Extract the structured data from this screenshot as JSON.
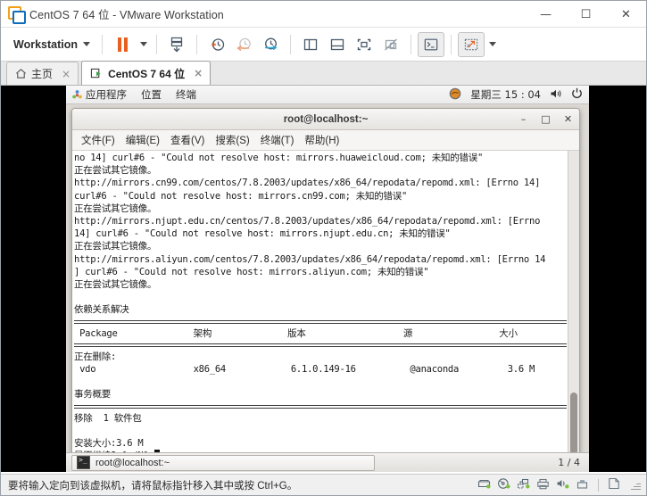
{
  "window": {
    "title": "CentOS 7 64 位 - VMware Workstation",
    "logo_icon": "vmware-logo-icon",
    "minimize_label": "—",
    "maximize_label": "☐",
    "close_label": "✕"
  },
  "toolbar": {
    "workstation_menu": "Workstation",
    "buttons": [
      {
        "name": "pause-vm-button",
        "icon": "pause-icon"
      },
      {
        "name": "pause-dropdown-button",
        "icon": "chevron-down-icon"
      },
      {
        "name": "snapshot-button",
        "icon": "snapshot-icon"
      },
      {
        "name": "take-snapshot-button",
        "icon": "clock-plus-icon"
      },
      {
        "name": "revert-snapshot-button",
        "icon": "clock-back-icon"
      },
      {
        "name": "snapshot-manager-button",
        "icon": "clock-wrench-icon"
      },
      {
        "name": "show-sidebar-button",
        "icon": "sidebar-panel-icon"
      },
      {
        "name": "show-thumbnail-bar-button",
        "icon": "bottom-panel-icon"
      },
      {
        "name": "full-screen-button",
        "icon": "fullscreen-icon"
      },
      {
        "name": "unity-mode-button",
        "icon": "unity-off-icon"
      },
      {
        "name": "console-view-button",
        "icon": "terminal-prompt-icon"
      },
      {
        "name": "stretch-guest-button",
        "icon": "stretch-icon"
      },
      {
        "name": "stretch-dropdown-button",
        "icon": "chevron-down-icon"
      }
    ]
  },
  "tabs": [
    {
      "name": "tab-home",
      "label": "主页",
      "icon": "home-icon",
      "close_label": "×",
      "active": false
    },
    {
      "name": "tab-centos",
      "label": "CentOS 7 64 位",
      "icon": "vm-screen-icon",
      "close_label": "×",
      "active": true
    }
  ],
  "guest": {
    "panel": {
      "applications": "应用程序",
      "places": "位置",
      "terminal": "终端",
      "tray_icon": "network-manager-icon",
      "clock": "星期三 15 : 04",
      "volume_icon": "volume-icon",
      "power_icon": "power-icon"
    },
    "terminal_window": {
      "title": "root@localhost:~",
      "minimize_label": "–",
      "maximize_label": "□",
      "close_label": "✕",
      "menu": [
        "文件(F)",
        "编辑(E)",
        "查看(V)",
        "搜索(S)",
        "终端(T)",
        "帮助(H)"
      ],
      "lines": [
        "no 14] curl#6 - \"Could not resolve host: mirrors.huaweicloud.com; 未知的错误\"",
        "正在尝试其它镜像。",
        "http://mirrors.cn99.com/centos/7.8.2003/updates/x86_64/repodata/repomd.xml: [Errno 14]",
        "curl#6 - \"Could not resolve host: mirrors.cn99.com; 未知的错误\"",
        "正在尝试其它镜像。",
        "http://mirrors.njupt.edu.cn/centos/7.8.2003/updates/x86_64/repodata/repomd.xml: [Errno",
        "14] curl#6 - \"Could not resolve host: mirrors.njupt.edu.cn; 未知的错误\"",
        "正在尝试其它镜像。",
        "http://mirrors.aliyun.com/centos/7.8.2003/updates/x86_64/repodata/repomd.xml: [Errno 14",
        "] curl#6 - \"Could not resolve host: mirrors.aliyun.com; 未知的错误\"",
        "正在尝试其它镜像。",
        "",
        "依赖关系解决",
        ""
      ],
      "table_header": " Package              架构              版本                  源                大小",
      "section_removing": "正在删除:",
      "package_row": " vdo                  x86_64            6.1.0.149-16          @anaconda         3.6 M",
      "transaction_summary": "事务概要",
      "remove_summary": "移除  1 软件包",
      "install_size": "安装大小:3.6 M",
      "prompt": "是否继续? [y/N]:",
      "cursor": "block-cursor"
    },
    "taskbar": {
      "task_label": "root@localhost:~",
      "task_icon": "terminal-icon",
      "workspace_indicator": "1 / 4"
    }
  },
  "statusbar": {
    "message": "要将输入定向到该虚拟机，请将鼠标指针移入其中或按 Ctrl+G。",
    "icons": [
      {
        "name": "hard-disk-icon"
      },
      {
        "name": "cd-dvd-icon"
      },
      {
        "name": "network-adapter-icon"
      },
      {
        "name": "printer-icon"
      },
      {
        "name": "sound-card-icon"
      },
      {
        "name": "usb-device-icon"
      },
      {
        "name": "message-log-icon"
      }
    ]
  },
  "colors": {
    "accent_orange": "#e8601f",
    "accent_blue": "#0f6cbd",
    "status_green": "#6ab023",
    "window_bg": "#ffffff"
  }
}
